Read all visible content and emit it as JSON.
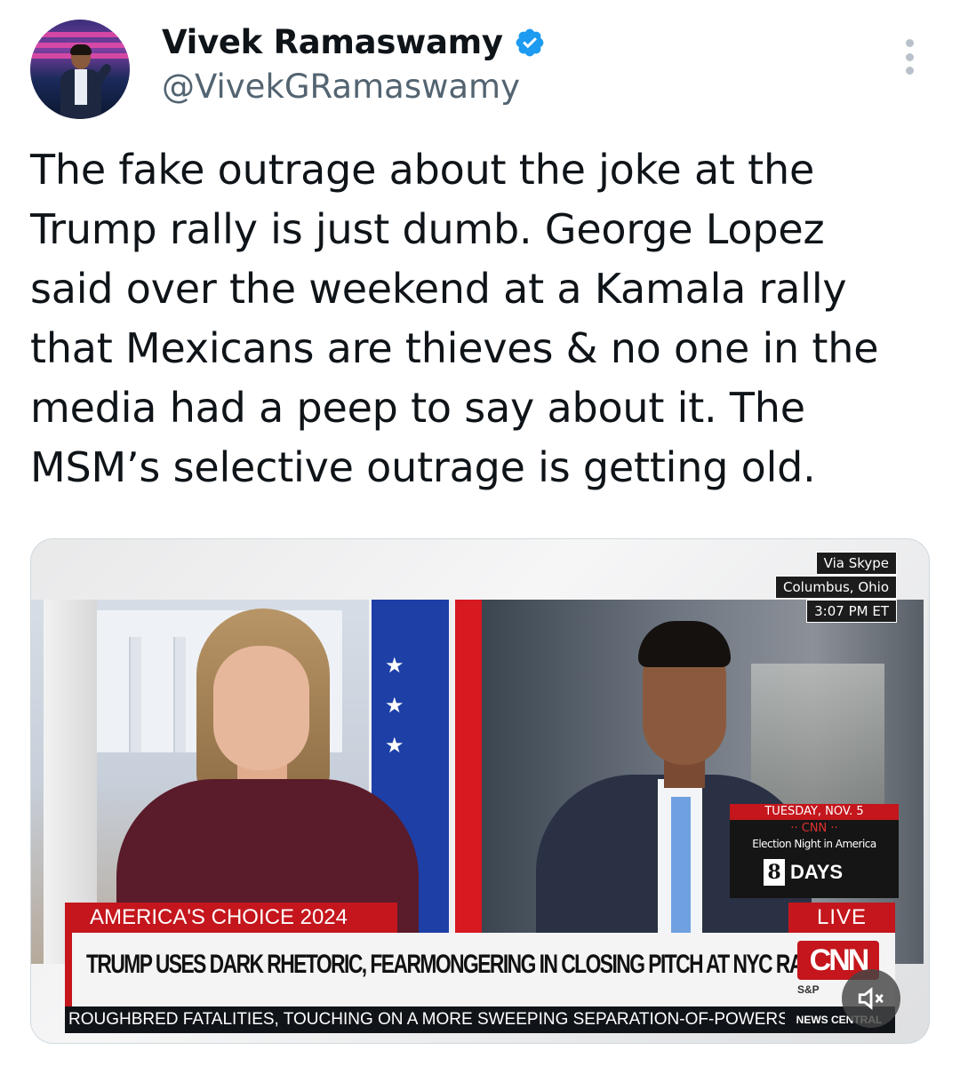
{
  "author": {
    "name": "Vivek Ramaswamy",
    "handle": "@VivekGRamaswamy",
    "verified_color": "#1d9bf0"
  },
  "tweet": {
    "lines": [
      "The fake outrage about the joke at the",
      "Trump rally is just dumb. George Lopez",
      "said over the weekend at a Kamala rally",
      "that Mexicans are thieves & no one in the",
      "media had a peep to say about it. The",
      "MSM’s selective outrage is getting old."
    ]
  },
  "video": {
    "tags": [
      "Via Skype",
      "Columbus, Ohio",
      "3:07 PM ET"
    ],
    "countdown": {
      "date": "TUESDAY, NOV. 5",
      "network": "·· CNN ··",
      "event": "Election Night in America",
      "number": "8",
      "unit": "DAYS"
    },
    "chyron_label": "AMERICA'S CHOICE 2024",
    "live_label": "LIVE",
    "headline": "TRUMP USES DARK RHETORIC, FEARMONGERING IN CLOSING PITCH AT NYC RALLY",
    "network_logo": "CNN",
    "index_label": "S&P",
    "ticker": "ROUGHBRED FATALITIES, TOUCHING ON A MORE SWEEPING SEPARATION-OF-POWERS",
    "ticker_badge": "NEWS CENTRAL",
    "brand_red": "#c4161c"
  },
  "icons": {
    "verified": "verified-badge-icon",
    "more": "more-options-icon",
    "mute": "muted-speaker-icon",
    "star": "star-icon"
  }
}
